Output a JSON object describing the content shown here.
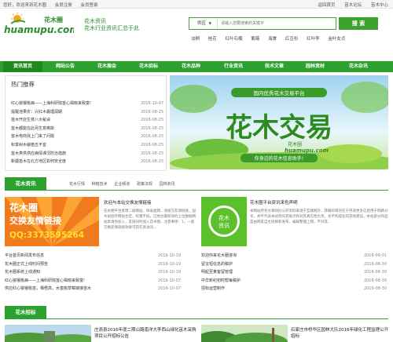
{
  "topbar": {
    "greeting": "您好，欢迎来到花木圈",
    "register": "会员注册",
    "login": "会员登录",
    "right_links": [
      "返回首页",
      "苗木论坛",
      "苗木中心"
    ]
  },
  "header": {
    "logo_cn": "花木圈",
    "logo_en": "huamupu.com",
    "slogan_line1": "花木资讯",
    "slogan_line2": "花木行业资讯汇总于此"
  },
  "search": {
    "category": "供应",
    "placeholder": "请输入您要搜索的关键字",
    "button": "搜 索",
    "hot_keywords": [
      "法桐",
      "桂花",
      "红叶石楠",
      "紫薇",
      "海棠",
      "红豆杉",
      "红叶李",
      "金叶女贞"
    ]
  },
  "nav": [
    "资讯首页",
    "网站公告",
    "花木展会",
    "花木招标",
    "花木品种",
    "行业资讯",
    "技术文章",
    "园林资材",
    "花木杂讯"
  ],
  "hot": {
    "title": "热门推荐",
    "items": [
      {
        "title": "红心猕猴桃病——上海科研院首心揭晓来致富!",
        "date": "2016-10-07"
      },
      {
        "title": "提醒池果农：兴红木霜理润期",
        "date": "2016-08-25"
      },
      {
        "title": "苗木开店生意八大秘诀",
        "date": "2016-08-25"
      },
      {
        "title": "苗木都能在此另生意奥斯",
        "date": "2016-08-25"
      },
      {
        "title": "苗木电商找上门来了问题",
        "date": "2016-08-25"
      },
      {
        "title": "秋季树木栽植五不宜",
        "date": "2016-08-25"
      },
      {
        "title": "苗木类供供应病情课况防治措施",
        "date": "2016-08-25"
      },
      {
        "title": "新疆苗木在北方地区如何安全度",
        "date": "2016-08-25"
      }
    ]
  },
  "banner": {
    "top": "国内优秀花木交易平台",
    "big": "花木交易",
    "logo_cn": "花木圈",
    "logo_en": "huamupu.com",
    "bottom": "你身边的花木信息助手!"
  },
  "news": {
    "tab": "花木资讯",
    "subtabs": [
      "花木行情",
      "种植技术",
      "企业频道",
      "政策法规",
      "园林资讯"
    ],
    "ad": {
      "line1": "花木圈",
      "line2": "交换友情链接",
      "line3": "QQ:3373595264",
      "title": "欢迎与本站交换友情链接",
      "body": "花木圈平台反馈二级网站，目录类网，请留交友请链接，园木站招存网站合定，权重不低，已经达最新效的上位数据网站类请你加入，友链同时加入花木圈，注意事项：1，一般交换友情链接效果可获在高访问..."
    },
    "side": {
      "icon_line1": "花木",
      "icon_line2": "资讯",
      "title": "花木圈平台资讯来色声明",
      "body": "本网站所有文章除好公开资料来源于互联网外，转载的目的在于传递更多信息用于网路分享，并不代表本站赞同其观点和对其真实性负责，也不构成任何其他建议。本站部分作品是由网友自主投稿和发布、编辑整理上网，不对其..."
    },
    "left_list": [
      {
        "title": "平台首页新闻发布信息",
        "date": "2016-10-19"
      },
      {
        "title": "花木圈正式上线时间预告",
        "date": "2016-10-19"
      },
      {
        "title": "花木圈系统上线通知",
        "date": "2016-10-19"
      },
      {
        "title": "红心猕猴桃病——上海科研院首心揭晓来致富!",
        "date": "2016-10-07"
      },
      {
        "title": "供应红心猕猴桃苗，栖梧高，水蜜桃草莓嫁接苗木",
        "date": "2016-10-07"
      }
    ],
    "right_list": [
      {
        "title": "欢迎你来花木圈咨询",
        "date": "2016-09-01"
      },
      {
        "title": "留言短信息的稿护",
        "date": "2016-08-30"
      },
      {
        "title": "明起至某客留管理",
        "date": "2016-08-30"
      },
      {
        "title": "中华新纪初时帮每稿护",
        "date": "2016-08-30"
      },
      {
        "title": "招标运营制作",
        "date": "2016-08-30"
      }
    ]
  },
  "bid": {
    "tab": "花木招标",
    "items": [
      "庄浪县2016年度二期山路南洋大李西山绿化苗木采购项目公开招标公告",
      "石家庄市桥华区园林大队2016年绿化工程监理公开招标"
    ]
  },
  "colors": {
    "brand_green": "#2ba12e",
    "nav_active": "#1d8a1f",
    "ad_orange": "#f07a1e",
    "ad_yellow": "#ffe12a"
  }
}
